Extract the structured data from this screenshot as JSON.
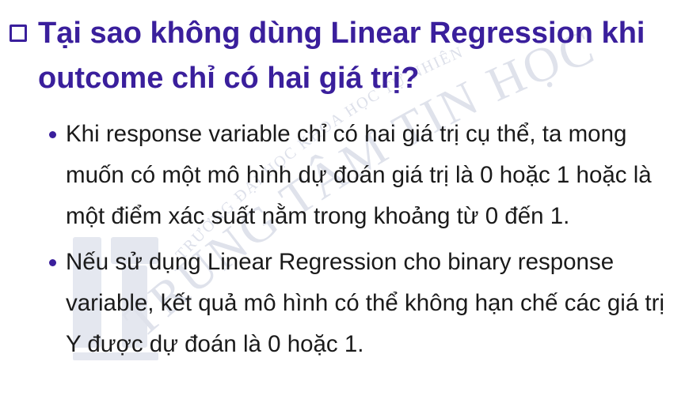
{
  "heading": {
    "text": "Tại sao không dùng Linear Regression khi outcome chỉ có hai giá trị?"
  },
  "bullets": [
    {
      "text": "Khi response variable chỉ có hai giá trị cụ thể, ta mong muốn có một mô hình dự đoán giá trị là 0 hoặc 1 hoặc là một điểm xác suất nằm trong khoảng từ 0 đến 1."
    },
    {
      "text": "Nếu sử dụng Linear Regression cho binary response variable, kết quả mô hình có thể không hạn chế các giá trị Y được dự đoán là 0 hoặc 1."
    }
  ],
  "watermark": {
    "main_text": "TRUNG TÂM TIN HỌC",
    "arc_text": "TRƯỜNG ĐẠI HỌC KHOA HỌC TỰ NHIÊN"
  },
  "colors": {
    "heading": "#3a1f9c",
    "body_text": "#1a1a1a",
    "bullet": "#3a1f9c",
    "watermark": "#d8dbe6"
  },
  "icons": {
    "heading_marker": "hollow-square-checkbox-icon",
    "list_marker": "filled-circle-bullet-icon"
  }
}
